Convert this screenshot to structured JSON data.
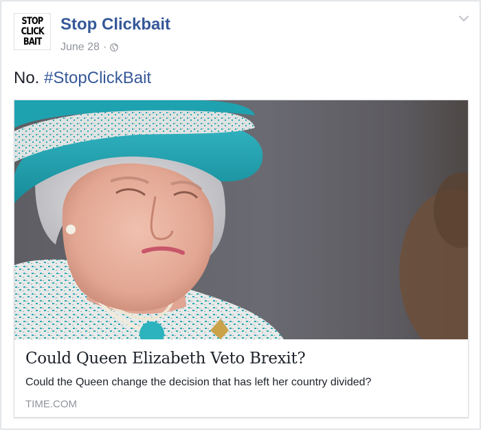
{
  "post": {
    "page_name": "Stop Clickbait",
    "avatar_lines": [
      "STOP",
      "CLICK",
      "BAIT"
    ],
    "date": "June 28",
    "separator": "·",
    "privacy_icon": "globe-icon",
    "menu_icon": "chevron-down-icon",
    "text": "No.",
    "hashtag": "#StopClickBait"
  },
  "link_preview": {
    "image": "photo-queen-elizabeth-turquoise-hat",
    "title": "Could Queen Elizabeth Veto Brexit?",
    "description": "Could the Queen change the decision that has left her country divided?",
    "domain": "TIME.COM"
  },
  "colors": {
    "link_blue": "#365899",
    "meta_gray": "#90949c",
    "text": "#1d2129",
    "hat_turquoise": "#1f9fae"
  }
}
